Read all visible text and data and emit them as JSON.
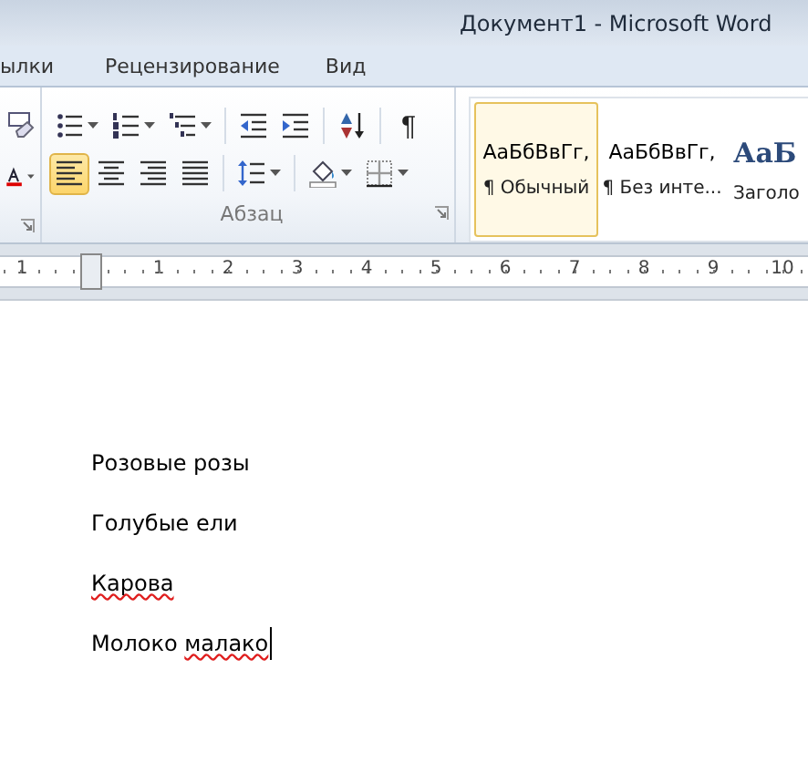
{
  "window": {
    "title": "Документ1  -  Microsoft Word"
  },
  "tabs": [
    {
      "label": "ылки",
      "selected": false
    },
    {
      "label": "Рецензирование",
      "selected": false
    },
    {
      "label": "Вид",
      "selected": false
    }
  ],
  "ribbon": {
    "font_group_fragment": {
      "buttons": [
        {
          "kind": "clear-format",
          "dropdown": false
        },
        {
          "kind": "font-color",
          "dropdown": true
        }
      ]
    },
    "paragraph_group": {
      "label": "Абзац",
      "rows": [
        [
          {
            "kind": "bullets",
            "dropdown": true,
            "selected": false
          },
          {
            "kind": "numbering",
            "dropdown": true,
            "selected": false
          },
          {
            "kind": "multilevel",
            "dropdown": true,
            "selected": false
          },
          {
            "kind": "sep"
          },
          {
            "kind": "outdent",
            "dropdown": false,
            "selected": false
          },
          {
            "kind": "indent",
            "dropdown": false,
            "selected": false
          },
          {
            "kind": "sep"
          },
          {
            "kind": "sort",
            "dropdown": false,
            "selected": false
          },
          {
            "kind": "sep"
          },
          {
            "kind": "pilcrow",
            "text": "¶",
            "dropdown": false,
            "selected": false
          }
        ],
        [
          {
            "kind": "align-left",
            "dropdown": false,
            "selected": true
          },
          {
            "kind": "align-center",
            "dropdown": false,
            "selected": false
          },
          {
            "kind": "align-right",
            "dropdown": false,
            "selected": false
          },
          {
            "kind": "justify",
            "dropdown": false,
            "selected": false
          },
          {
            "kind": "sep"
          },
          {
            "kind": "line-spacing",
            "dropdown": true,
            "selected": false
          },
          {
            "kind": "sep"
          },
          {
            "kind": "shading",
            "dropdown": true,
            "selected": false
          },
          {
            "kind": "borders",
            "dropdown": true,
            "selected": false
          }
        ]
      ]
    },
    "styles_gallery": [
      {
        "kind": "body",
        "sample": "АаБбВвГг,",
        "name": "¶ Обычный",
        "selected": true
      },
      {
        "kind": "body",
        "sample": "АаБбВвГг,",
        "name": "¶ Без инте...",
        "selected": false
      },
      {
        "kind": "heading",
        "sample": "АаБ",
        "name": "Заголо",
        "selected": false
      }
    ]
  },
  "ruler": {
    "labels": [
      "1",
      "1",
      "2",
      "3",
      "4",
      "5",
      "6",
      "7",
      "8",
      "9",
      "10"
    ]
  },
  "document": {
    "paragraphs": [
      {
        "segments": [
          {
            "text": "Розовые розы",
            "misspelled": false
          }
        ],
        "cursor": false
      },
      {
        "segments": [
          {
            "text": "Голубые ели",
            "misspelled": false
          }
        ],
        "cursor": false
      },
      {
        "segments": [
          {
            "text": "Карова",
            "misspelled": true
          }
        ],
        "cursor": false
      },
      {
        "segments": [
          {
            "text": "Молоко ",
            "misspelled": false
          },
          {
            "text": "малако",
            "misspelled": true
          }
        ],
        "cursor": true
      }
    ]
  }
}
